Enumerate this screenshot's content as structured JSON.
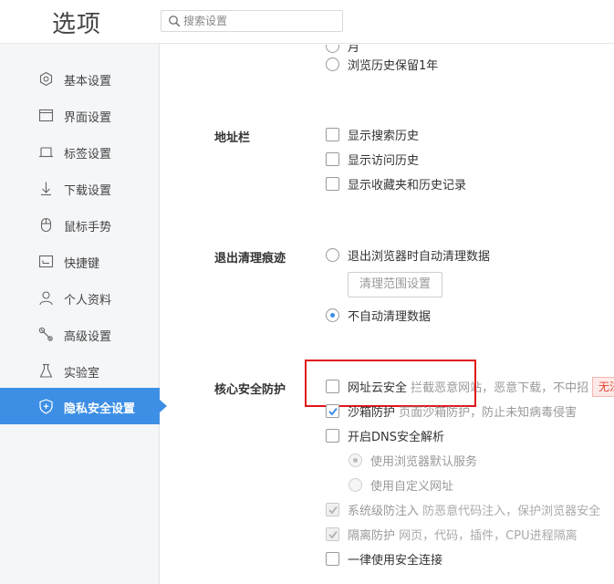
{
  "header": {
    "title": "选项",
    "search_placeholder": "搜索设置"
  },
  "sidebar": {
    "items": [
      {
        "label": "基本设置",
        "icon": "hexagon-gear-icon"
      },
      {
        "label": "界面设置",
        "icon": "window-icon"
      },
      {
        "label": "标签设置",
        "icon": "tab-icon"
      },
      {
        "label": "下载设置",
        "icon": "download-icon"
      },
      {
        "label": "鼠标手势",
        "icon": "mouse-icon"
      },
      {
        "label": "快捷键",
        "icon": "keyboard-icon"
      },
      {
        "label": "个人资料",
        "icon": "user-icon"
      },
      {
        "label": "高级设置",
        "icon": "wrench-icon"
      },
      {
        "label": "实验室",
        "icon": "flask-icon"
      },
      {
        "label": "隐私安全设置",
        "icon": "shield-plus-icon",
        "active": true
      }
    ]
  },
  "history": {
    "partial_option_text": "月",
    "keep_one_year": "浏览历史保留1年"
  },
  "address_bar": {
    "label": "地址栏",
    "options": [
      "显示搜索历史",
      "显示访问历史",
      "显示收藏夹和历史记录"
    ]
  },
  "exit_cleanup": {
    "label": "退出清理痕迹",
    "auto_clean": "退出浏览器时自动清理数据",
    "range_button": "清理范围设置",
    "no_auto_clean": "不自动清理数据"
  },
  "core_security": {
    "label": "核心安全防护",
    "url_cloud": {
      "title": "网址云安全",
      "desc": "拦截恶意网站，恶意下载，不中招",
      "tag": "无法"
    },
    "sandbox": {
      "title": "沙箱防护",
      "desc": "页面沙箱防护，防止未知病毒侵害"
    },
    "dns": {
      "title": "开启DNS安全解析"
    },
    "dns_default": "使用浏览器默认服务",
    "dns_custom": "使用自定义网址",
    "system_injection": {
      "title": "系统级防注入",
      "desc": "防恶意代码注入，保护浏览器安全"
    },
    "isolation": {
      "title": "隔离防护",
      "desc": "网页，代码，插件，CPU进程隔离"
    },
    "always_secure": "一律使用安全连接"
  },
  "colors": {
    "accent": "#3d8fe5",
    "highlight": "#e0151a",
    "sidebar_bg": "#f5f6f8"
  }
}
